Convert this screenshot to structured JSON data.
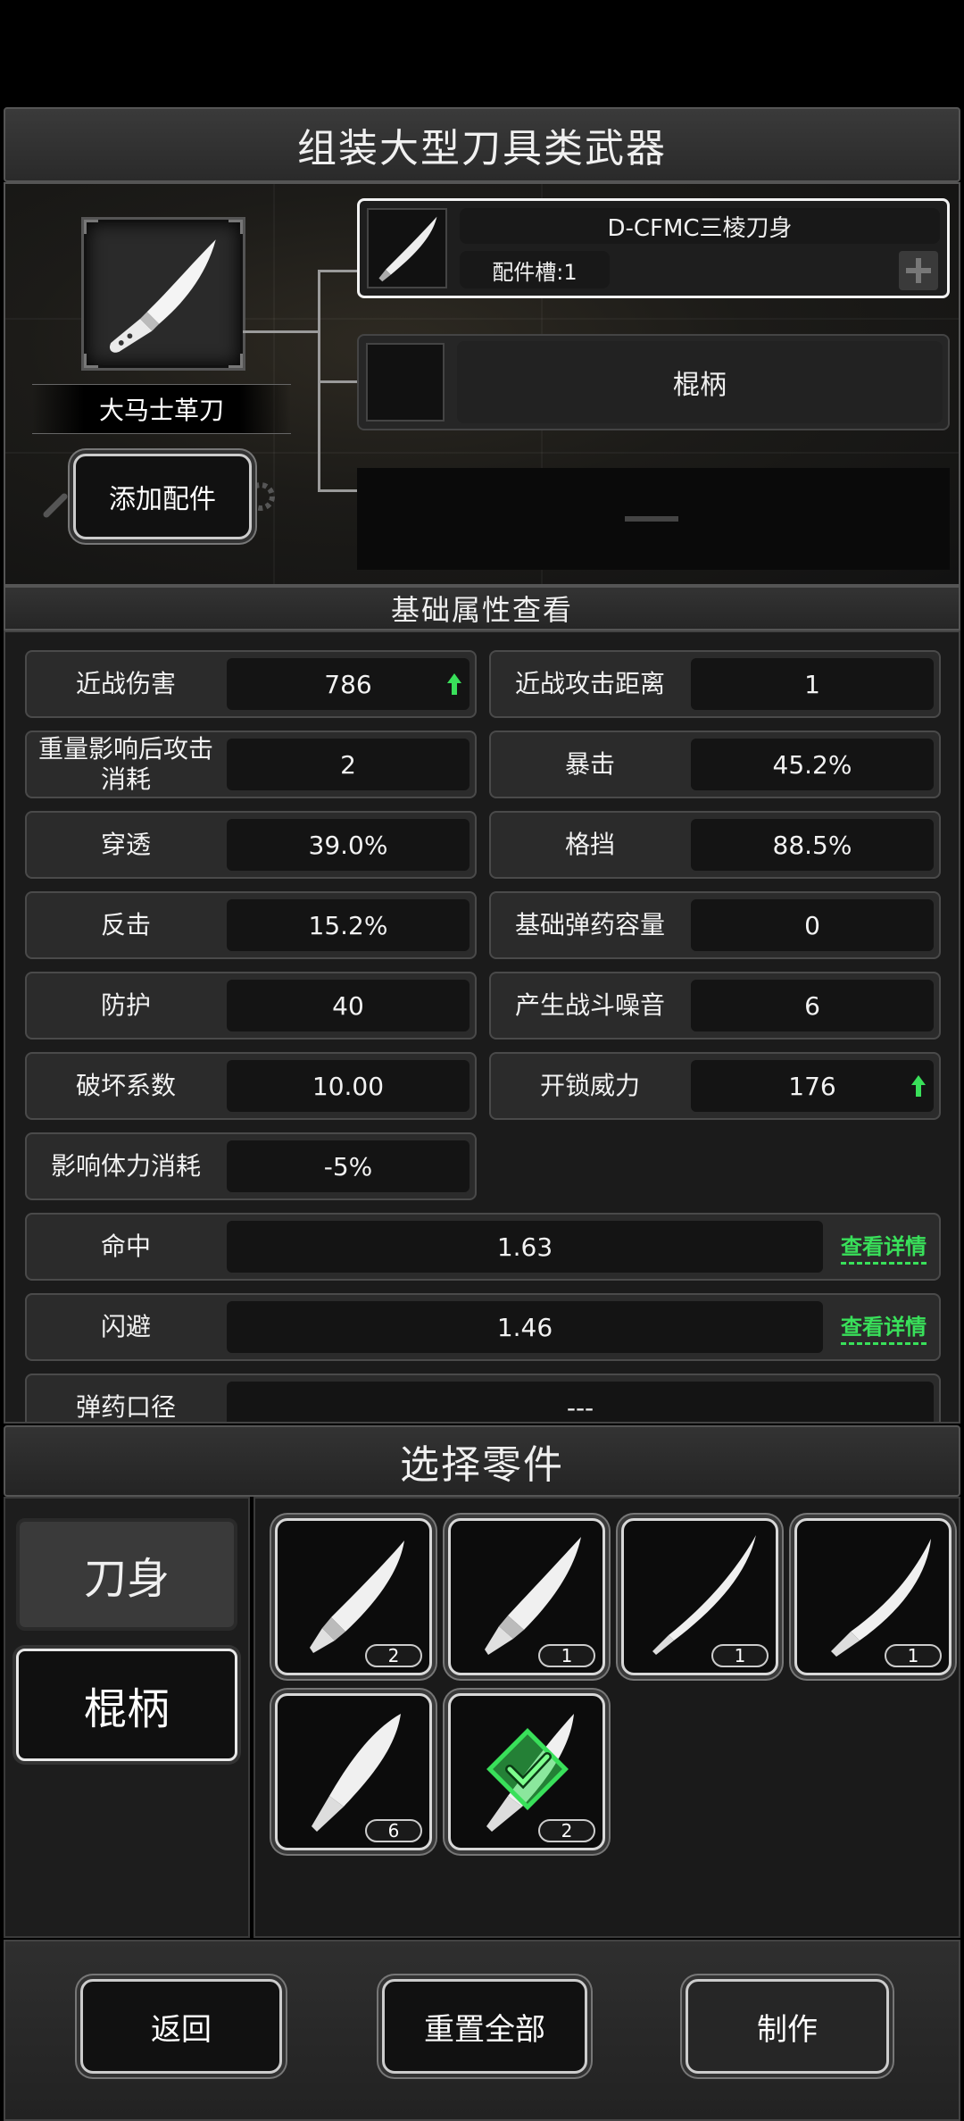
{
  "header": {
    "title": "组装大型刀具类武器"
  },
  "weapon": {
    "name": "大马士革刀",
    "add_part_label": "添加配件"
  },
  "slots": [
    {
      "name": "D-CFMC三棱刀身",
      "sub": "配件槽:1",
      "add_icon": "plus-icon"
    },
    {
      "name": "棍柄"
    },
    {
      "name": "—"
    }
  ],
  "stats_section": {
    "title": "基础属性查看"
  },
  "stats": [
    {
      "label": "近战伤害",
      "value": "786",
      "trend": "up"
    },
    {
      "label": "近战攻击距离",
      "value": "1"
    },
    {
      "label": "重量影响后攻击消耗",
      "value": "2"
    },
    {
      "label": "暴击",
      "value": "45.2%"
    },
    {
      "label": "穿透",
      "value": "39.0%"
    },
    {
      "label": "格挡",
      "value": "88.5%"
    },
    {
      "label": "反击",
      "value": "15.2%"
    },
    {
      "label": "基础弹药容量",
      "value": "0"
    },
    {
      "label": "防护",
      "value": "40"
    },
    {
      "label": "产生战斗噪音",
      "value": "6"
    },
    {
      "label": "破坏系数",
      "value": "10.00"
    },
    {
      "label": "开锁威力",
      "value": "176",
      "trend": "up"
    },
    {
      "label": "影响体力消耗",
      "value": "-5%"
    }
  ],
  "wide_stats": [
    {
      "label": "命中",
      "value": "1.63",
      "link": "查看详情"
    },
    {
      "label": "闪避",
      "value": "1.46",
      "link": "查看详情"
    },
    {
      "label": "弹药口径",
      "value": "---"
    }
  ],
  "parts_section": {
    "title": "选择零件"
  },
  "categories": [
    {
      "label": "刀身",
      "state": "active"
    },
    {
      "label": "棍柄",
      "state": "inactive"
    }
  ],
  "parts": [
    {
      "count": "2",
      "icon": "blade-icon"
    },
    {
      "count": "1",
      "icon": "blade-icon"
    },
    {
      "count": "1",
      "icon": "serrated-blade-icon"
    },
    {
      "count": "1",
      "icon": "machete-blade-icon"
    },
    {
      "count": "6",
      "icon": "curved-blade-icon"
    },
    {
      "count": "2",
      "icon": "blade-icon",
      "selected": true
    }
  ],
  "buttons": {
    "back": "返回",
    "reset": "重置全部",
    "make": "制作"
  },
  "colors": {
    "accent_green": "#39e05a",
    "panel": "#2b2b2b",
    "value_bg": "#141414"
  }
}
